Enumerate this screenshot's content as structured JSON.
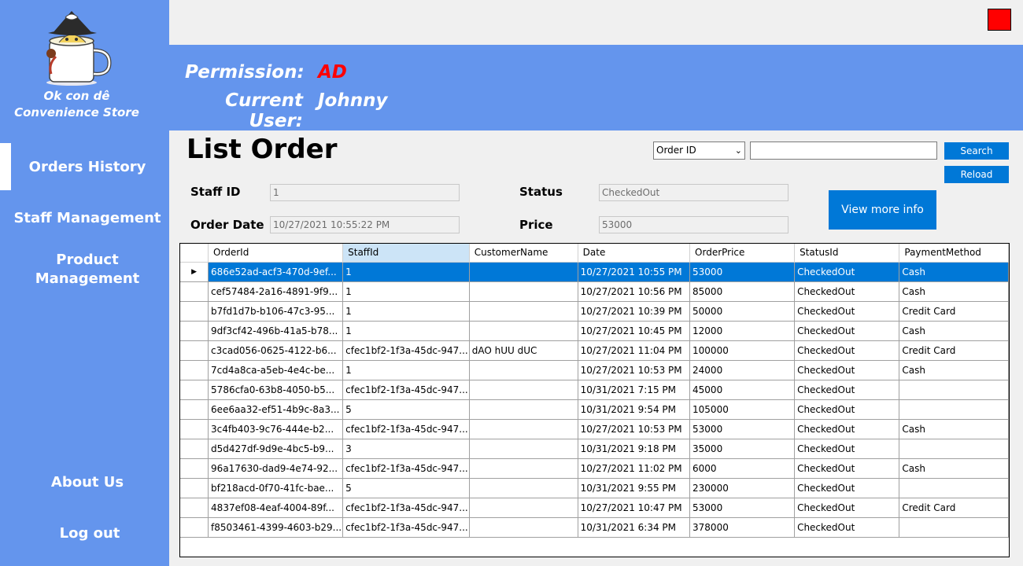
{
  "sidebar": {
    "store_name_line1": "Ok con dê",
    "store_name_line2": "Convenience Store",
    "nav": {
      "orders_history": "Orders History",
      "staff_management": "Staff Management",
      "product_management_line1": "Product",
      "product_management_line2": "Management",
      "about_us": "About Us",
      "log_out": "Log out"
    }
  },
  "header": {
    "permission_label": "Permission:",
    "permission_value": "AD",
    "user_label": "Current User:",
    "user_value": "Johnny"
  },
  "page": {
    "title": "List Order"
  },
  "search": {
    "field_selected": "Order ID",
    "query": "",
    "search_label": "Search",
    "reload_label": "Reload",
    "view_more_label": "View more info"
  },
  "details": {
    "staff_id_label": "Staff ID",
    "staff_id_value": "1",
    "status_label": "Status",
    "status_value": "CheckedOut",
    "order_date_label": "Order Date",
    "order_date_value": "10/27/2021 10:55:22 PM",
    "price_label": "Price",
    "price_value": "53000"
  },
  "colors": {
    "sidebar": "#6495ed",
    "accent": "#0078d7",
    "permission": "#ff0000",
    "close": "#ff0000"
  },
  "grid": {
    "columns": [
      "OrderId",
      "StaffId",
      "CustomerName",
      "Date",
      "OrderPrice",
      "StatusId",
      "PaymentMethod"
    ],
    "rows": [
      [
        "686e52ad-acf3-470d-9ef...",
        "1",
        "",
        "10/27/2021 10:55 PM",
        "53000",
        "CheckedOut",
        "Cash"
      ],
      [
        "cef57484-2a16-4891-9f9...",
        "1",
        "",
        "10/27/2021 10:56 PM",
        "85000",
        "CheckedOut",
        "Cash"
      ],
      [
        "b7fd1d7b-b106-47c3-95...",
        "1",
        "",
        "10/27/2021 10:39 PM",
        "50000",
        "CheckedOut",
        "Credit Card"
      ],
      [
        "9df3cf42-496b-41a5-b78...",
        "1",
        "",
        "10/27/2021 10:45 PM",
        "12000",
        "CheckedOut",
        "Cash"
      ],
      [
        "c3cad056-0625-4122-b6...",
        "cfec1bf2-1f3a-45dc-947...",
        "dAO hUU dUC",
        "10/27/2021 11:04 PM",
        "100000",
        "CheckedOut",
        "Credit Card"
      ],
      [
        "7cd4a8ca-a5eb-4e4c-be...",
        "1",
        "",
        "10/27/2021 10:53 PM",
        "24000",
        "CheckedOut",
        "Cash"
      ],
      [
        "5786cfa0-63b8-4050-b5...",
        "cfec1bf2-1f3a-45dc-947...",
        "",
        "10/31/2021 7:15 PM",
        "45000",
        "CheckedOut",
        ""
      ],
      [
        "6ee6aa32-ef51-4b9c-8a3...",
        "5",
        "",
        "10/31/2021 9:54 PM",
        "105000",
        "CheckedOut",
        ""
      ],
      [
        "3c4fb403-9c76-444e-b2...",
        "cfec1bf2-1f3a-45dc-947...",
        "",
        "10/27/2021 10:53 PM",
        "53000",
        "CheckedOut",
        "Cash"
      ],
      [
        "d5d427df-9d9e-4bc5-b9...",
        "3",
        "",
        "10/31/2021 9:18 PM",
        "35000",
        "CheckedOut",
        ""
      ],
      [
        "96a17630-dad9-4e74-92...",
        "cfec1bf2-1f3a-45dc-947...",
        "",
        "10/27/2021 11:02 PM",
        "6000",
        "CheckedOut",
        "Cash"
      ],
      [
        "bf218acd-0f70-41fc-bae...",
        "5",
        "",
        "10/31/2021 9:55 PM",
        "230000",
        "CheckedOut",
        ""
      ],
      [
        "4837ef08-4eaf-4004-89f...",
        "cfec1bf2-1f3a-45dc-947...",
        "",
        "10/27/2021 10:47 PM",
        "53000",
        "CheckedOut",
        "Credit Card"
      ],
      [
        "f8503461-4399-4603-b29...",
        "cfec1bf2-1f3a-45dc-947...",
        "",
        "10/31/2021 6:34 PM",
        "378000",
        "CheckedOut",
        ""
      ]
    ]
  }
}
